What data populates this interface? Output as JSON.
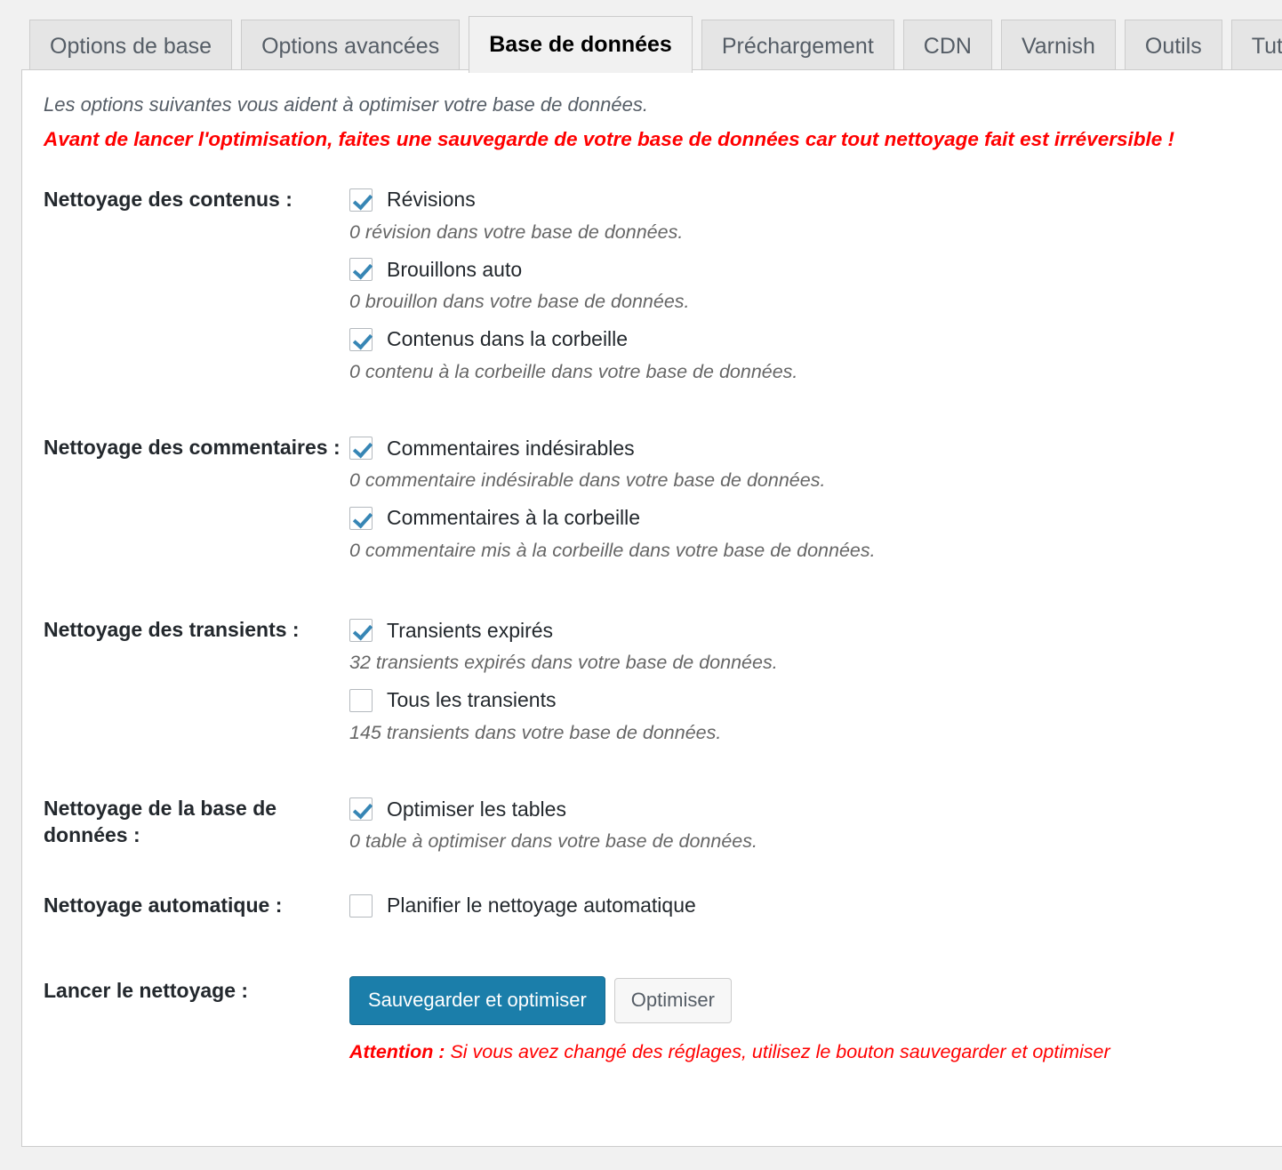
{
  "tabs": [
    {
      "label": "Options de base",
      "active": false
    },
    {
      "label": "Options avancées",
      "active": false
    },
    {
      "label": "Base de données",
      "active": true
    },
    {
      "label": "Préchargement",
      "active": false
    },
    {
      "label": "CDN",
      "active": false
    },
    {
      "label": "Varnish",
      "active": false
    },
    {
      "label": "Outils",
      "active": false
    },
    {
      "label": "Tutoriels",
      "active": false
    }
  ],
  "intro": {
    "line1": "Les options suivantes vous aident à optimiser votre base de données.",
    "line2": "Avant de lancer l'optimisation, faites une sauvegarde de votre base de données car tout nettoyage fait est irréversible !"
  },
  "sections": {
    "contents": {
      "label": "Nettoyage des contenus :",
      "items": [
        {
          "label": "Révisions",
          "checked": true,
          "desc": "0 révision dans votre base de données."
        },
        {
          "label": "Brouillons auto",
          "checked": true,
          "desc": "0 brouillon dans votre base de données."
        },
        {
          "label": "Contenus dans la corbeille",
          "checked": true,
          "desc": "0 contenu à la corbeille dans votre base de données."
        }
      ]
    },
    "comments": {
      "label": "Nettoyage des commentaires :",
      "items": [
        {
          "label": "Commentaires indésirables",
          "checked": true,
          "desc": "0 commentaire indésirable dans votre base de données."
        },
        {
          "label": "Commentaires à la corbeille",
          "checked": true,
          "desc": "0 commentaire mis à la corbeille dans votre base de données."
        }
      ]
    },
    "transients": {
      "label": "Nettoyage des transients :",
      "items": [
        {
          "label": "Transients expirés",
          "checked": true,
          "desc": "32 transients expirés dans votre base de données."
        },
        {
          "label": "Tous les transients",
          "checked": false,
          "desc": "145 transients dans votre base de données."
        }
      ]
    },
    "database": {
      "label": "Nettoyage de la base de données :",
      "items": [
        {
          "label": "Optimiser les tables",
          "checked": true,
          "desc": "0 table à optimiser dans votre base de données."
        }
      ]
    },
    "auto": {
      "label": "Nettoyage automatique :",
      "items": [
        {
          "label": "Planifier le nettoyage automatique",
          "checked": false
        }
      ]
    },
    "run": {
      "label": "Lancer le nettoyage :",
      "primary_button": "Sauvegarder et optimiser",
      "secondary_button": "Optimiser",
      "attention_bold": "Attention :",
      "attention_text": "Si vous avez changé des réglages, utilisez le bouton sauvegarder et optimiser"
    }
  },
  "colors": {
    "primary_button": "#1b7eaa",
    "checkmark": "#3786b5",
    "warning_red": "#ff0000",
    "label_text": "#23282d",
    "desc_text": "#666666"
  }
}
